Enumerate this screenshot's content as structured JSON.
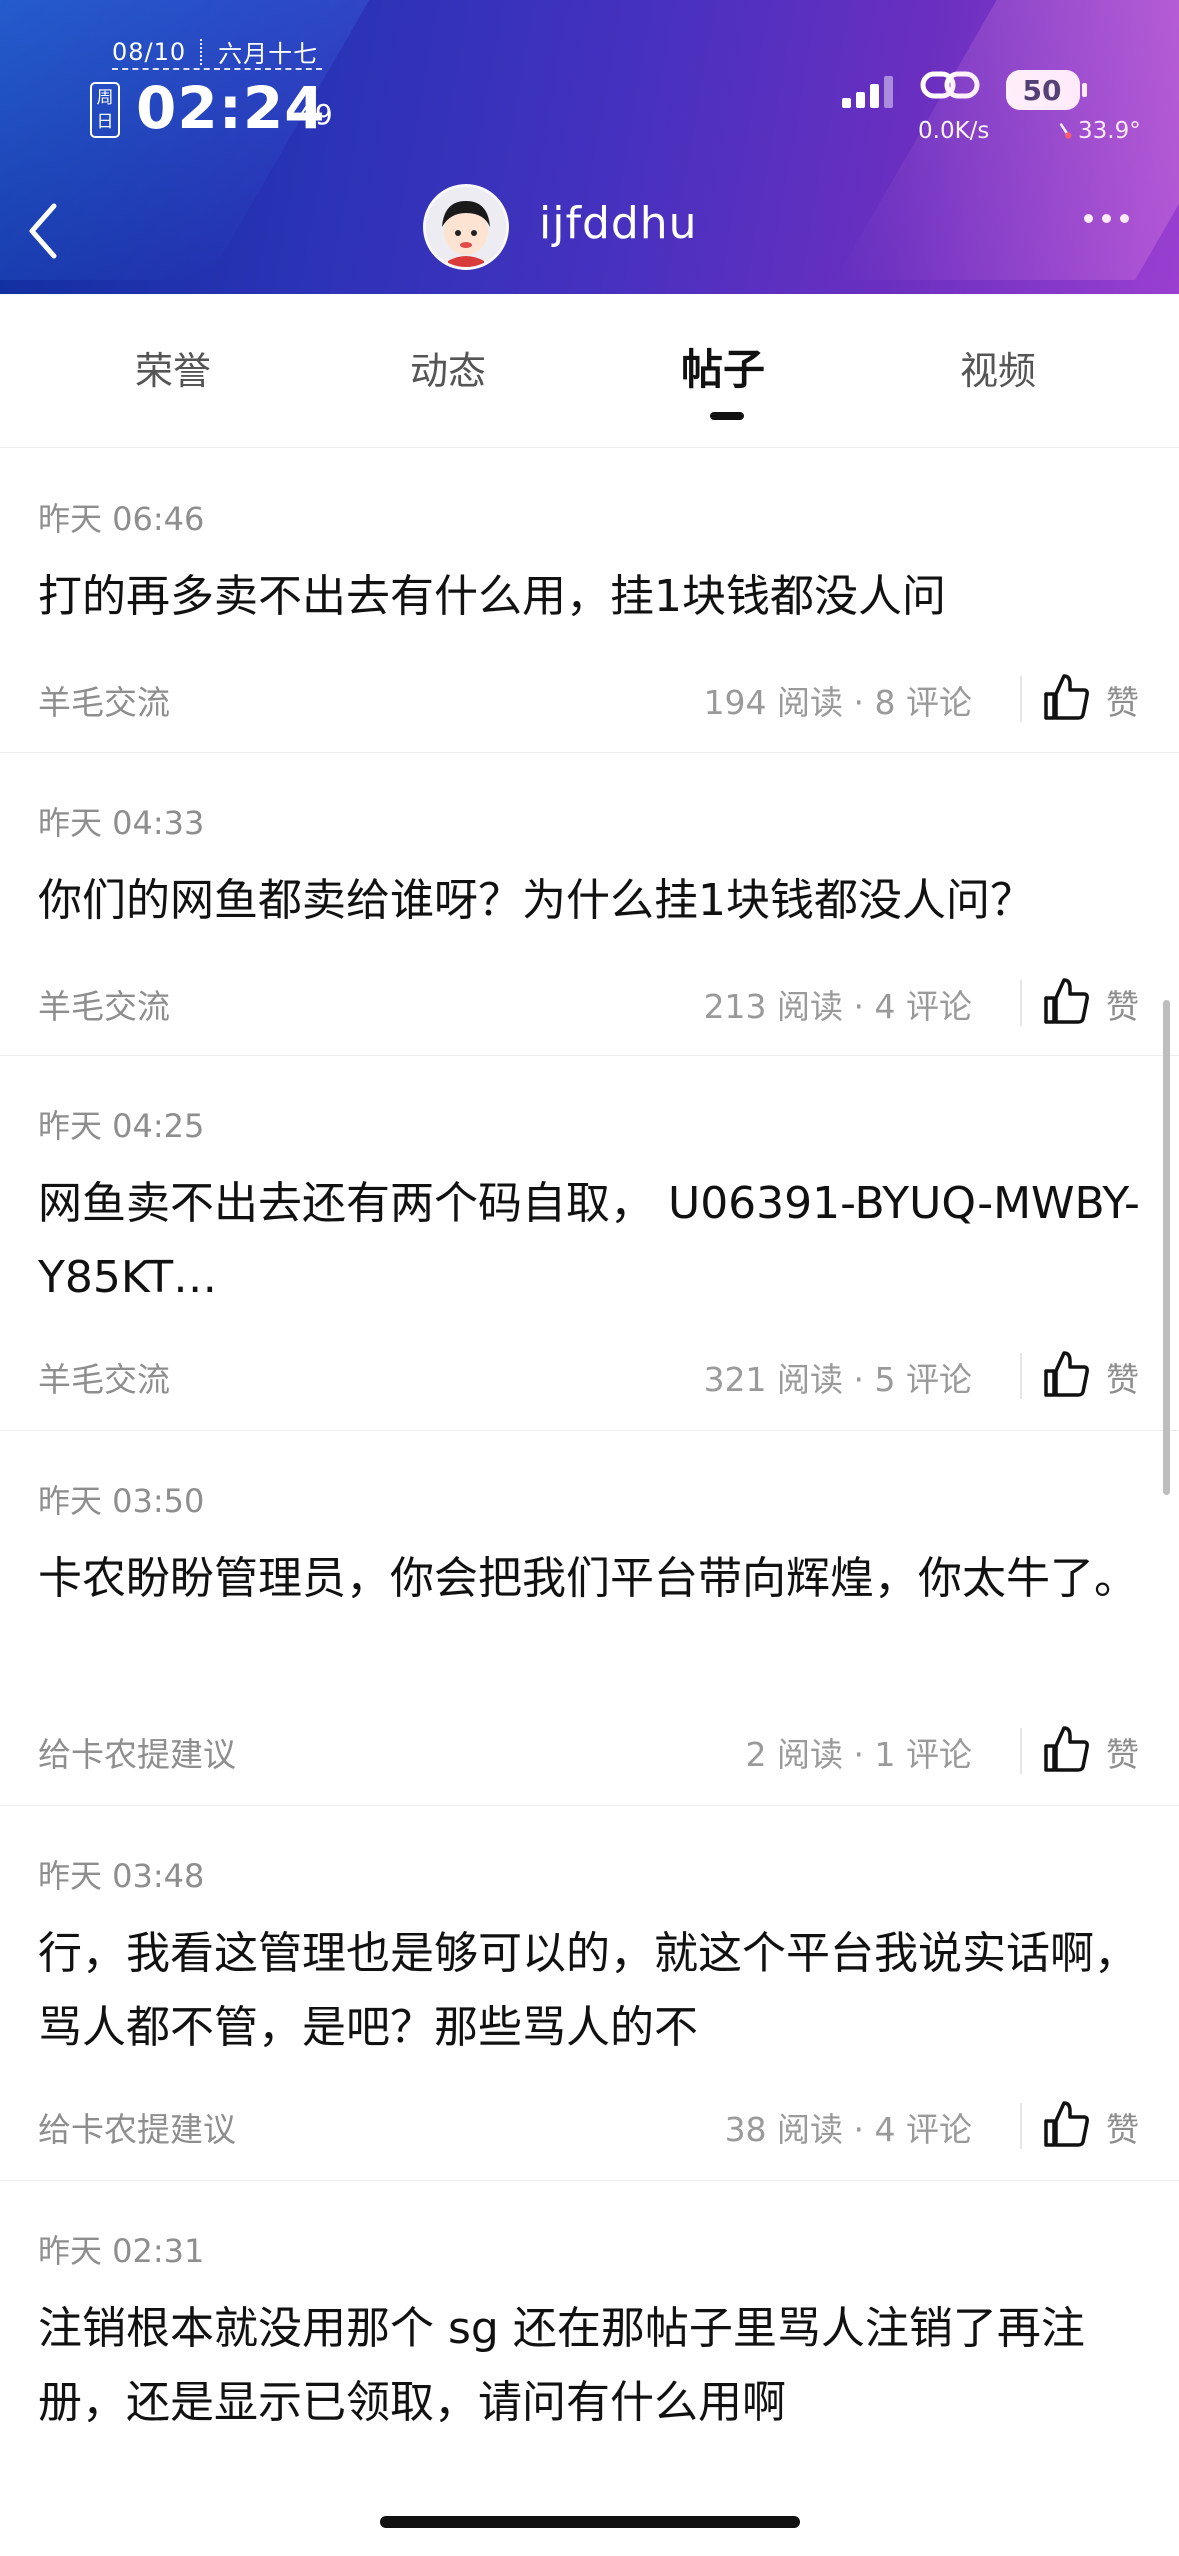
{
  "status_bar": {
    "date": "08/10",
    "lunar_date": "六月十七",
    "weekday": "周日",
    "weekday_top": "周",
    "weekday_bottom": "日",
    "time_main": "02:24",
    "time_seconds": "49",
    "net_speed": "0.0K/s",
    "battery": "50",
    "temperature": "33.9°"
  },
  "header": {
    "back_icon": "back-chevron-icon",
    "username": "ijfddhu",
    "more_icon": "more-dots-icon"
  },
  "tabs": [
    {
      "label": "荣誉",
      "active": false
    },
    {
      "label": "动态",
      "active": false
    },
    {
      "label": "帖子",
      "active": true
    },
    {
      "label": "视频",
      "active": false
    }
  ],
  "posts": [
    {
      "time": "昨天 06:46",
      "title": "打的再多卖不出去有什么用，挂1块钱都没人问",
      "category": "羊毛交流",
      "stats": "194 阅读 · 8 评论",
      "like_label": "赞"
    },
    {
      "time": "昨天 04:33",
      "title": "你们的网鱼都卖给谁呀？为什么挂1块钱都没人问？",
      "category": "羊毛交流",
      "stats": "213 阅读 · 4 评论",
      "like_label": "赞"
    },
    {
      "time": "昨天 04:25",
      "title": "网鱼卖不出去还有两个码自取， U06391-BYUQ-MWBY-Y85KT…",
      "category": "羊毛交流",
      "stats": "321 阅读 · 5 评论",
      "like_label": "赞"
    },
    {
      "time": "昨天 03:50",
      "title": "卡农盼盼管理员，你会把我们平台带向辉煌，你太牛了。",
      "category": "给卡农提建议",
      "stats": "2 阅读 · 1 评论",
      "like_label": "赞"
    },
    {
      "time": "昨天 03:48",
      "title": "行，我看这管理也是够可以的，就这个平台我说实话啊，骂人都不管，是吧？那些骂人的不",
      "category": "给卡农提建议",
      "stats": "38 阅读 · 4 评论",
      "like_label": "赞"
    },
    {
      "time": "昨天 02:31",
      "title": "注销根本就没用那个 sg 还在那帖子里骂人注销了再注册，还是显示已领取，请问有什么用啊",
      "category": "",
      "stats": "",
      "like_label": ""
    }
  ],
  "colors": {
    "header_start": "#0f2f9e",
    "header_end": "#9a3fd0",
    "muted_text": "#8e8e8e"
  }
}
